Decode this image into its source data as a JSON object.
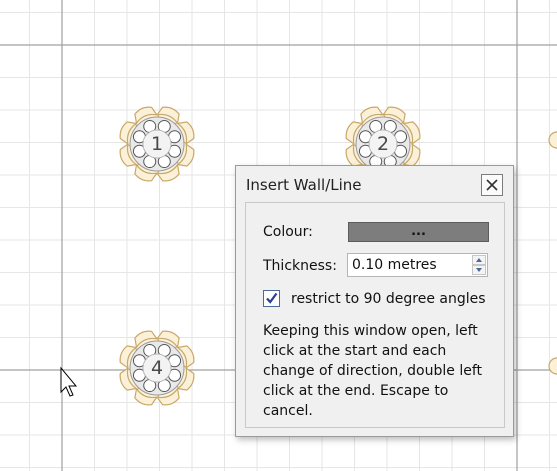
{
  "tables": [
    {
      "number": "1"
    },
    {
      "number": "2"
    },
    {
      "number": "4"
    }
  ],
  "dialog": {
    "title": "Insert Wall/Line",
    "close_icon": "close-icon",
    "colour_label": "Colour:",
    "colour_button_label": "...",
    "colour_value": "#7d7d7d",
    "thickness_label": "Thickness:",
    "thickness_value": "0.10 metres",
    "restrict_checked": true,
    "restrict_label": "restrict to 90 degree angles",
    "help_text": "Keeping this window open, left click at the start and each change of direction, double left click at the end. Escape to cancel."
  },
  "colors": {
    "grid": "#e6e6e6",
    "grid_major": "#a0a0a0",
    "chair_fill": "#fbf1d9",
    "chair_stroke": "#c9a867",
    "table_fill": "#e9e9e9"
  }
}
